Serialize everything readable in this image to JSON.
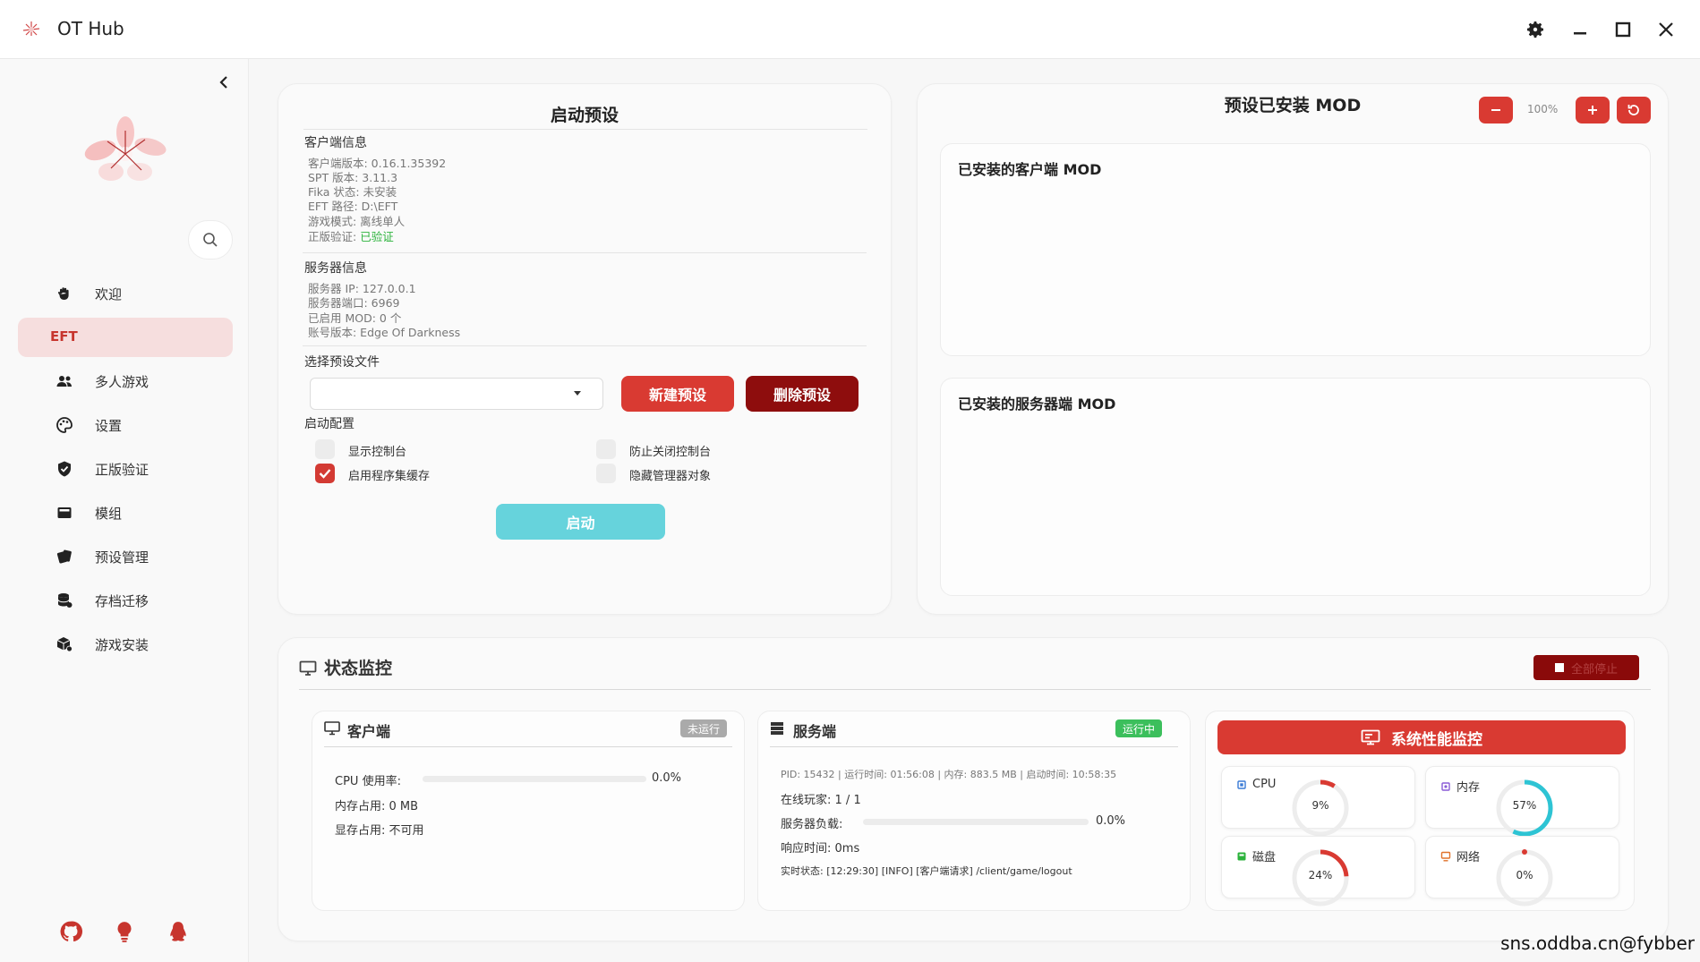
{
  "window": {
    "title": "OT Hub"
  },
  "sidebar": {
    "items": [
      {
        "label": "欢迎",
        "icon": "wave-hand-icon"
      },
      {
        "label": "EFT",
        "icon": "",
        "active": true
      },
      {
        "label": "多人游戏",
        "icon": "people-icon"
      },
      {
        "label": "设置",
        "icon": "palette-icon"
      },
      {
        "label": "正版验证",
        "icon": "shield-check-icon"
      },
      {
        "label": "模组",
        "icon": "module-icon"
      },
      {
        "label": "预设管理",
        "icon": "cards-icon"
      },
      {
        "label": "存档迁移",
        "icon": "database-icon"
      },
      {
        "label": "游戏安装",
        "icon": "box-install-icon"
      }
    ]
  },
  "launch_preset": {
    "title": "启动预设",
    "client_info_title": "客户端信息",
    "client_info": [
      {
        "text": "客户端版本: 0.16.1.35392"
      },
      {
        "text": "SPT 版本: 3.11.3"
      },
      {
        "text": "Fika 状态: 未安装"
      },
      {
        "text": "EFT 路径: D:\\EFT"
      },
      {
        "text": "游戏模式: 离线单人"
      }
    ],
    "verify_label": "正版验证: ",
    "verify_value": "已验证",
    "server_info_title": "服务器信息",
    "server_info": [
      {
        "text": "服务器 IP: 127.0.0.1"
      },
      {
        "text": "服务器端口: 6969"
      },
      {
        "text": "已启用 MOD: 0 个"
      },
      {
        "text": "账号版本: Edge Of Darkness"
      }
    ],
    "select_title": "选择预设文件",
    "select_value": "",
    "new_button": "新建预设",
    "delete_button": "删除预设",
    "config_title": "启动配置",
    "options": [
      {
        "label": "显示控制台",
        "checked": false
      },
      {
        "label": "防止关闭控制台",
        "checked": false
      },
      {
        "label": "启用程序集缓存",
        "checked": true
      },
      {
        "label": "隐藏管理器对象",
        "checked": false
      }
    ],
    "start_button": "启动"
  },
  "mods": {
    "title": "预设已安装 MOD",
    "zoom": "100%",
    "client_title": "已安装的客户端 MOD",
    "server_title": "已安装的服务器端 MOD"
  },
  "status": {
    "title": "状态监控",
    "stop_all": "全部停止",
    "client": {
      "title": "客户端",
      "badge": "未运行",
      "cpu_label": "CPU 使用率:",
      "cpu_value": "0.0%",
      "mem_label": "内存占用:",
      "mem_value": "0 MB",
      "vram_label": "显存占用:",
      "vram_value": "不可用"
    },
    "server": {
      "title": "服务端",
      "badge": "运行中",
      "meta": "PID: 15432 | 运行时间: 01:56:08 | 内存: 883.5 MB | 启动时间: 10:58:35",
      "players_label": "在线玩家:",
      "players_value": "1 / 1",
      "load_label": "服务器负载:",
      "load_value": "0.0%",
      "resp_label": "响应时间:",
      "resp_value": "0ms",
      "realtime_label": "实时状态:",
      "realtime_value": "[12:29:30] [INFO] [客户端请求] /client/game/logout"
    },
    "perf": {
      "title": "系统性能监控",
      "items": [
        {
          "label": "CPU",
          "value": "9%",
          "fraction": 0.09,
          "color": "#d93a32",
          "icon": "cpu-icon",
          "icon_color": "#3a7bd5"
        },
        {
          "label": "内存",
          "value": "57%",
          "fraction": 0.57,
          "color": "#2ec4d4",
          "icon": "memory-chip-icon",
          "icon_color": "#8a5cd6"
        },
        {
          "label": "磁盘",
          "value": "24%",
          "fraction": 0.24,
          "color": "#d93a32",
          "icon": "disk-icon",
          "icon_color": "#2cb33c"
        },
        {
          "label": "网络",
          "value": "0%",
          "fraction": 0.0,
          "color": "#d93a32",
          "icon": "network-icon",
          "icon_color": "#e0732c"
        }
      ]
    }
  },
  "watermark": "sns.oddba.cn@fybber",
  "colors": {
    "accent": "#d93a32",
    "dark_red": "#8e0d0d",
    "start": "#66d3dc",
    "ok_green": "#2cb33c"
  }
}
